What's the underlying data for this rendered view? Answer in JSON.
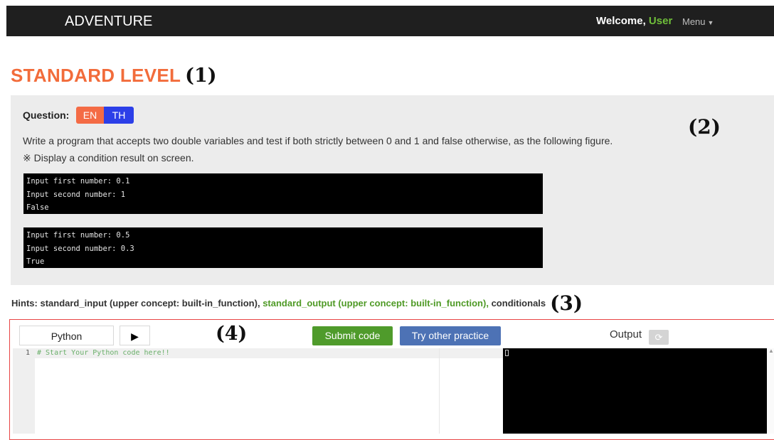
{
  "navbar": {
    "brand": "ADVENTURE",
    "welcome": "Welcome,",
    "user": "User",
    "menu": "Menu"
  },
  "page": {
    "level_title": "STANDARD LEVEL",
    "marker_1": "(1)",
    "marker_2": "(2)",
    "marker_3": "(3)",
    "marker_4": "(4)"
  },
  "question": {
    "label": "Question:",
    "lang_en": "EN",
    "lang_th": "TH",
    "text": "Write a program that accepts two double variables and test if both strictly between 0 and 1 and false otherwise, as the following figure.",
    "note": "※ Display a condition result on screen.",
    "examples": [
      [
        "Input first number: 0.1",
        "Input second number: 1",
        "False"
      ],
      [
        "Input first number: 0.5",
        "Input second number: 0.3",
        "True"
      ]
    ]
  },
  "hints": {
    "label": "Hints:",
    "item1": "standard_input (upper concept: built-in_function),",
    "item2": "standard_output (upper concept: built-in_function),",
    "item3": "conditionals"
  },
  "editor": {
    "language": "Python",
    "run_icon": "▶",
    "submit": "Submit code",
    "try_other": "Try other practice",
    "output_label": "Output",
    "refresh_icon": "⟳",
    "line_number": "1",
    "code": "# Start Your Python code here!!"
  },
  "colors": {
    "accent_orange": "#f26c3b",
    "green": "#4f9b2b",
    "blue": "#4d72b5",
    "th_blue": "#2c3fe8",
    "highlight_border": "#e84545"
  }
}
